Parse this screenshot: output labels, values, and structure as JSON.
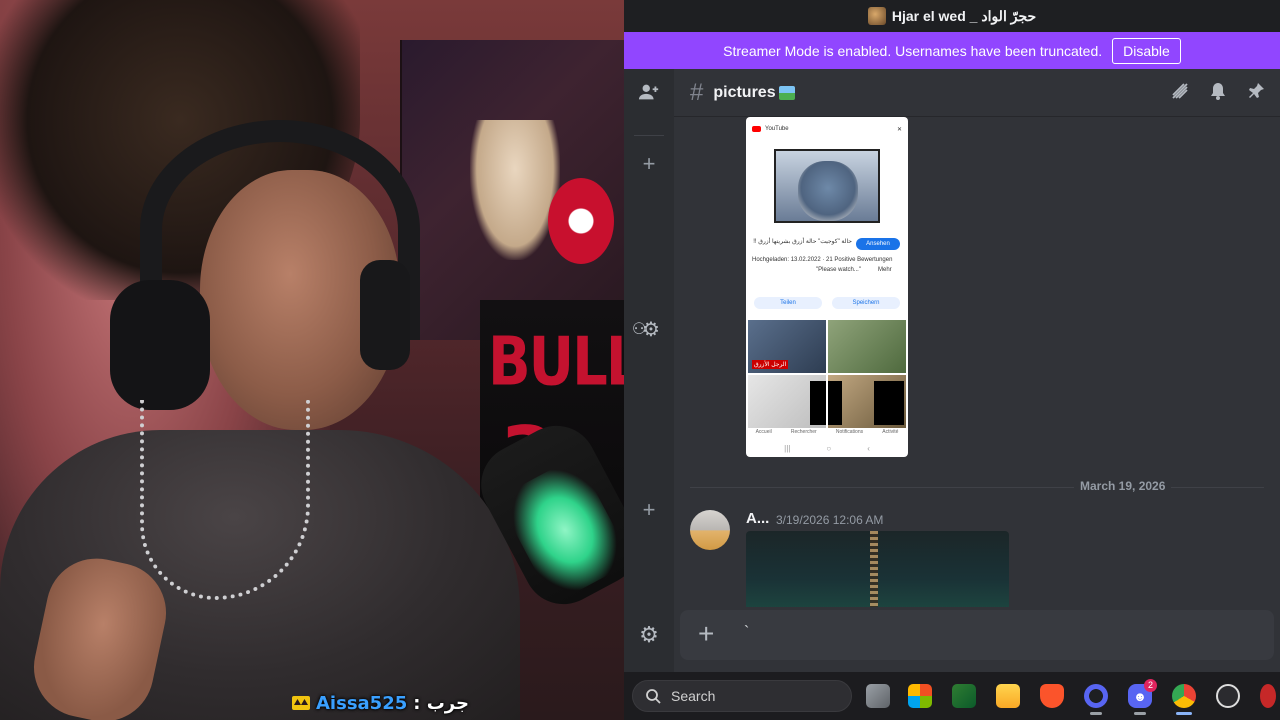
{
  "overlay": {
    "chat_user": "Aissa525",
    "chat_message": "جرب :"
  },
  "discord": {
    "window_title": "Hjar el wed _ حجرّ الواد",
    "streamer_notice": "Streamer Mode is enabled. Usernames have been truncated.",
    "disable_label": "Disable",
    "channel_name": "pictures",
    "date_divider": "March 19, 2026",
    "message_author": "A...",
    "message_timestamp": "3/19/2026 12:06 AM",
    "composer_value": "`",
    "screenshot": {
      "app_label": "YouTube",
      "title_line": "حالة \"كوجيت\" حالة أزرق بشريتها أزرق !!",
      "meta_line": "Hochgeladen: 13.02.2022 · 21 Positive Bewertungen",
      "desc_line": "\"Please watch...\"",
      "more_label": "Mehr",
      "view_button": "Ansehen",
      "share_label": "Teilen",
      "save_label": "Speichern",
      "tile_caption": "الرجل الأزرق",
      "nav_items": [
        "Accueil",
        "Rechercher",
        "Notifications",
        "Activité"
      ]
    }
  },
  "taskbar": {
    "search_placeholder": "Search",
    "discord_badge": "2"
  },
  "colors": {
    "discord_bg": "#313338",
    "streamer_bar": "#9146ff",
    "taskbar": "#1c1c1f"
  }
}
